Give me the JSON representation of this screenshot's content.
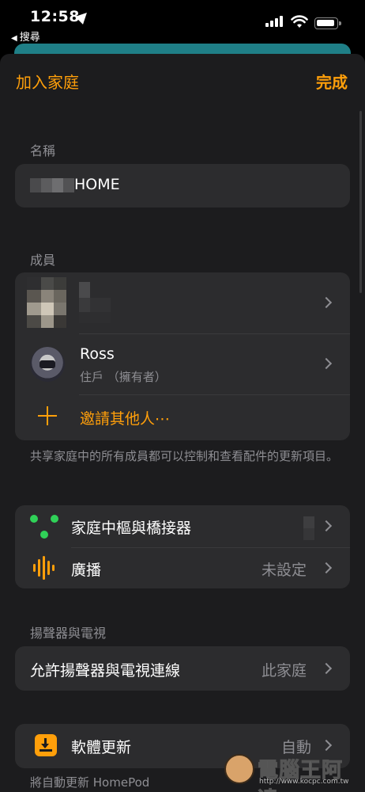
{
  "status_bar": {
    "time": "12:58",
    "back_app": "搜尋"
  },
  "nav": {
    "left": "加入家庭",
    "right": "完成"
  },
  "name_section": {
    "label": "名稱",
    "value": "HOME"
  },
  "members_section": {
    "label": "成員",
    "members": [
      {
        "name": "Ross",
        "role": "住戶 （擁有者）"
      }
    ],
    "invite": "邀請其他人⋯",
    "footer": "共享家庭中的所有成員都可以控制和查看配件的更新項目。"
  },
  "hub_section": {
    "hub_label": "家庭中樞與橋接器",
    "broadcast_label": "廣播",
    "broadcast_value": "未設定"
  },
  "speakers_section": {
    "label": "揚聲器與電視",
    "allow_label": "允許揚聲器與電視連線",
    "allow_value": "此家庭"
  },
  "software_section": {
    "label": "軟體更新",
    "value": "自動",
    "footer": "將自動更新 HomePod"
  },
  "watermark": {
    "text": "電腦王阿達",
    "url": "http://www.kocpc.com.tw"
  },
  "colors": {
    "accent": "#ff9f0a",
    "hub_green": "#30d158",
    "background": "#1c1c1e",
    "cell": "#2c2c2e"
  }
}
